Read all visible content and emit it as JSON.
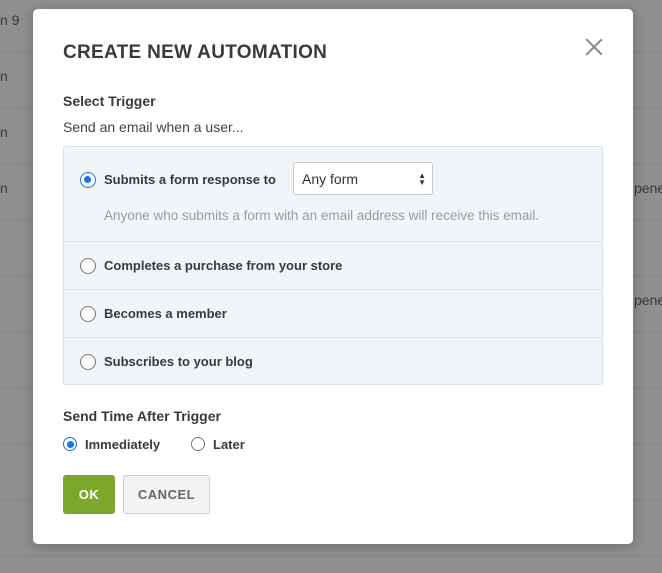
{
  "background": {
    "rows": [
      {
        "left": "n 9",
        "right": ""
      },
      {
        "left": "n",
        "right": ""
      },
      {
        "left": "n",
        "right": ""
      },
      {
        "left": "n",
        "right": "pene"
      },
      {
        "left": "",
        "right": ""
      },
      {
        "left": "",
        "right": "pene"
      },
      {
        "left": "",
        "right": ""
      },
      {
        "left": "",
        "right": ""
      },
      {
        "left": "",
        "right": ""
      },
      {
        "left": "",
        "right": ""
      }
    ]
  },
  "modal": {
    "title": "CREATE NEW AUTOMATION",
    "trigger": {
      "label": "Select Trigger",
      "subtext": "Send an email when a user...",
      "options": [
        {
          "label": "Submits a form response to",
          "checked": true
        },
        {
          "label": "Completes a purchase from your store",
          "checked": false
        },
        {
          "label": "Becomes a member",
          "checked": false
        },
        {
          "label": "Subscribes to your blog",
          "checked": false
        }
      ],
      "form_select": {
        "value": "Any form"
      },
      "hint": "Anyone who submits a form with an email address will receive this email."
    },
    "send_time": {
      "label": "Send Time After Trigger",
      "options": [
        {
          "label": "Immediately",
          "checked": true
        },
        {
          "label": "Later",
          "checked": false
        }
      ]
    },
    "buttons": {
      "ok": "OK",
      "cancel": "CANCEL"
    }
  },
  "colors": {
    "accent": "#1a73e8",
    "ok_button": "#7ba82a"
  },
  "icons": {
    "close": "close-icon",
    "select_arrows": "updown-arrows-icon"
  }
}
